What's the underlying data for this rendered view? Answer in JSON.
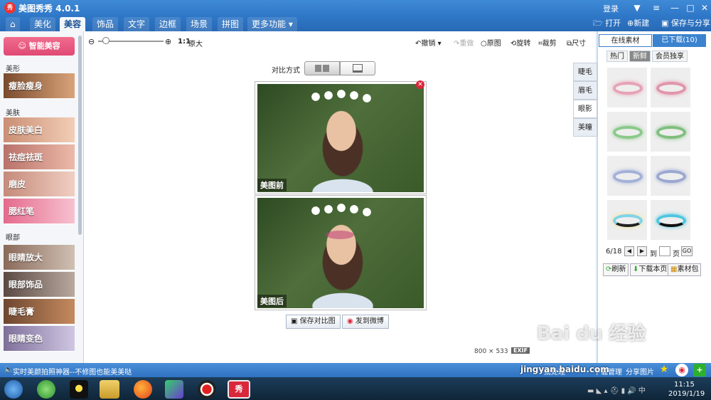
{
  "app": {
    "title": "美图秀秀 4.0.1",
    "icon": "秀",
    "login": "登录"
  },
  "nav": {
    "tabs": [
      "美化",
      "美容",
      "饰品",
      "文字",
      "边框",
      "场景",
      "拼图",
      "更多功能"
    ],
    "open": "打开",
    "new": "新建",
    "save": "保存与分享"
  },
  "left": {
    "smart": "智能美容",
    "sections": [
      "美形",
      "美肤",
      "眼部"
    ],
    "items": [
      "瘦脸瘦身",
      "皮肤美白",
      "祛痘祛斑",
      "磨皮",
      "腮红笔",
      "眼睛放大",
      "眼部饰品",
      "睫毛膏",
      "眼睛变色"
    ]
  },
  "toolbar": {
    "zoom": "1:1",
    "orig_size": "原大",
    "undo": "撤销",
    "redo": "重做",
    "original": "原图",
    "rotate": "旋转",
    "crop": "裁剪",
    "size": "尺寸"
  },
  "compare": {
    "label": "对比方式",
    "before": "美图前",
    "after": "美图后",
    "save_btn": "保存对比图",
    "weibo_btn": "发到微博"
  },
  "image_info": {
    "dims": "800 × 533",
    "exif": "EXIF"
  },
  "side_tabs": [
    "睫毛",
    "眉毛",
    "眼影",
    "美瞳"
  ],
  "right": {
    "tab_online": "在线素材",
    "tab_downloaded": "已下载(10)",
    "subtabs": [
      "热门",
      "新鲜",
      "会员独享"
    ],
    "page": "6/18",
    "to": "到",
    "page_unit": "页",
    "go": "GO",
    "refresh": "刷新",
    "download_page": "下载本页",
    "material_pack": "素材包"
  },
  "status": {
    "left": "实时美颜拍照神器--不修图也能美美哒",
    "batch": "批处理",
    "download_mgr": "下载管理",
    "share": "分享图片"
  },
  "taskbar": {
    "time": "11:15",
    "date": "2019/1/19"
  },
  "watermark": {
    "top": "Bai du 经验",
    "bottom": "jingyan.baidu.com"
  }
}
